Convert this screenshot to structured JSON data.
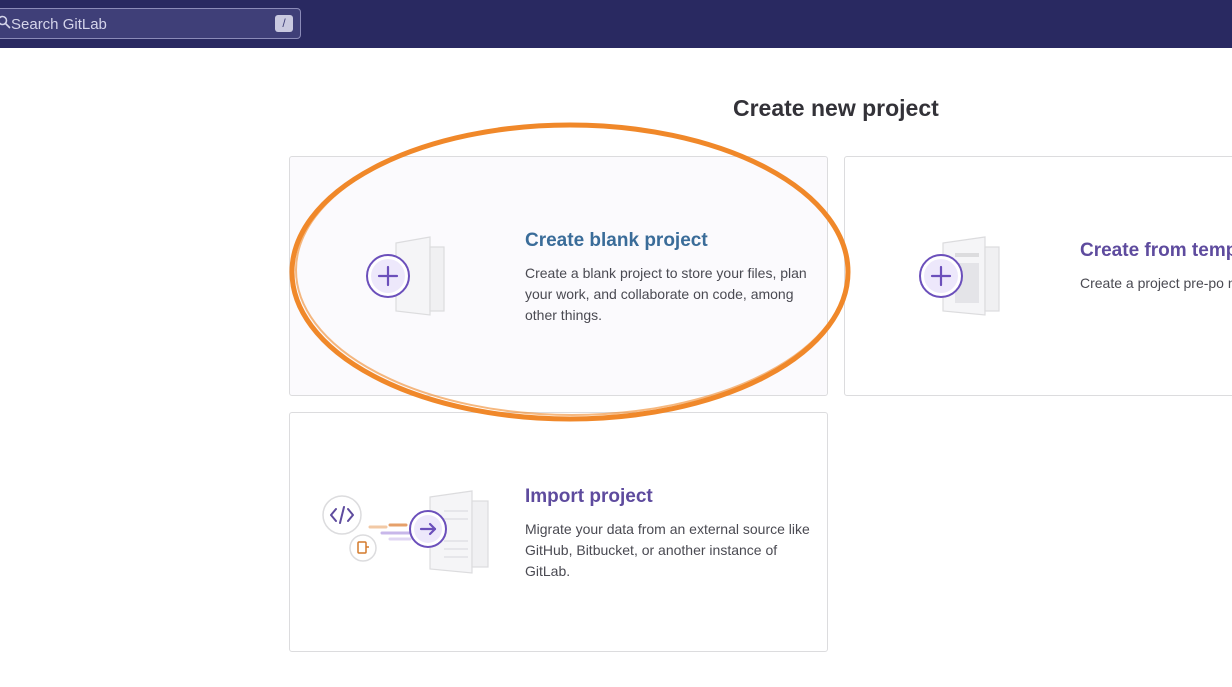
{
  "header": {
    "search_placeholder": "Search GitLab",
    "search_shortcut": "/"
  },
  "page": {
    "title": "Create new project"
  },
  "cards": {
    "blank": {
      "title": "Create blank project",
      "description": "Create a blank project to store your files, plan your work, and collaborate on code, among other things."
    },
    "template": {
      "title": "Create from temp",
      "description": "Create a project pre-po necessary files to get y"
    },
    "import": {
      "title": "Import project",
      "description": "Migrate your data from an external source like GitHub, Bitbucket, or another instance of GitLab."
    }
  },
  "colors": {
    "header_bg": "#292961",
    "accent_purple": "#6b4fbb",
    "annotation_orange": "#f0882a"
  }
}
